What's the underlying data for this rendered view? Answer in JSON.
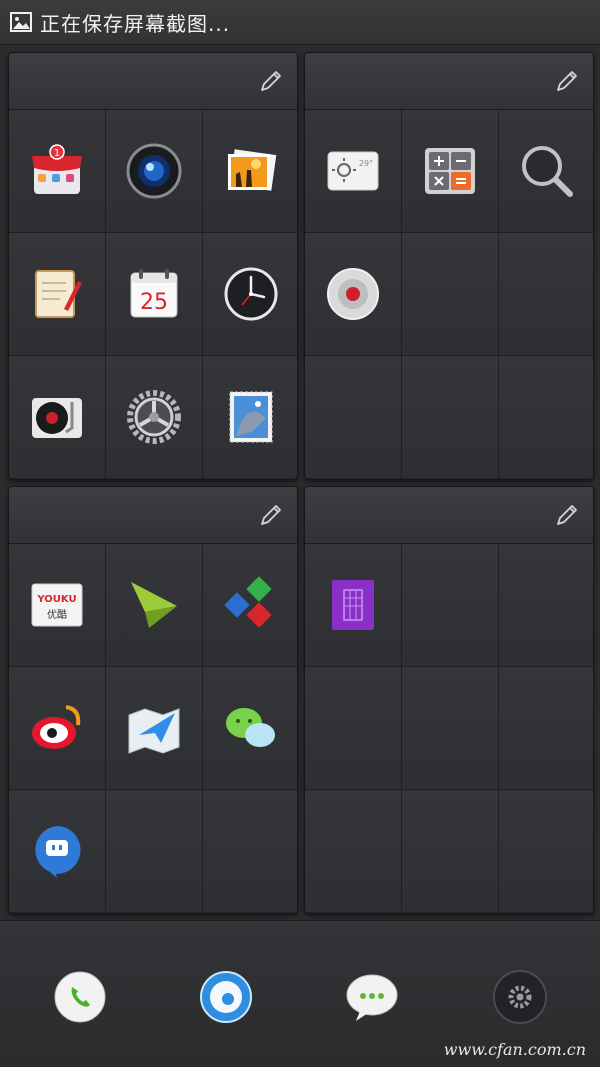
{
  "status_bar": {
    "text": "正在保存屏幕截图...",
    "icon": "image-icon"
  },
  "panels": [
    {
      "edit_icon": "pencil-icon",
      "apps": [
        {
          "icon": "app-store-icon",
          "badge": "1"
        },
        {
          "icon": "camera-icon"
        },
        {
          "icon": "gallery-icon"
        },
        {
          "icon": "notes-icon"
        },
        {
          "icon": "calendar-icon",
          "day": "25"
        },
        {
          "icon": "clock-icon"
        },
        {
          "icon": "music-player-icon"
        },
        {
          "icon": "settings-icon"
        },
        {
          "icon": "mail-icon"
        }
      ]
    },
    {
      "edit_icon": "pencil-icon",
      "apps": [
        {
          "icon": "weather-icon",
          "temp": "29°"
        },
        {
          "icon": "calculator-icon"
        },
        {
          "icon": "search-icon"
        },
        {
          "icon": "recorder-icon"
        }
      ]
    },
    {
      "edit_icon": "pencil-icon",
      "apps": [
        {
          "icon": "youku-icon",
          "label_top": "YOUKU",
          "label_bottom": "优酷"
        },
        {
          "icon": "paper-plane-icon"
        },
        {
          "icon": "office-cubes-icon"
        },
        {
          "icon": "weibo-icon"
        },
        {
          "icon": "maps-icon"
        },
        {
          "icon": "wechat-icon"
        },
        {
          "icon": "chat-bubble-icon"
        }
      ]
    },
    {
      "edit_icon": "pencil-icon",
      "apps": [
        {
          "icon": "purple-book-icon"
        }
      ]
    }
  ],
  "dock": [
    {
      "icon": "phone-icon"
    },
    {
      "icon": "browser-icon"
    },
    {
      "icon": "messages-icon"
    },
    {
      "icon": "gear-icon"
    }
  ],
  "watermark": "www.cfan.com.cn"
}
